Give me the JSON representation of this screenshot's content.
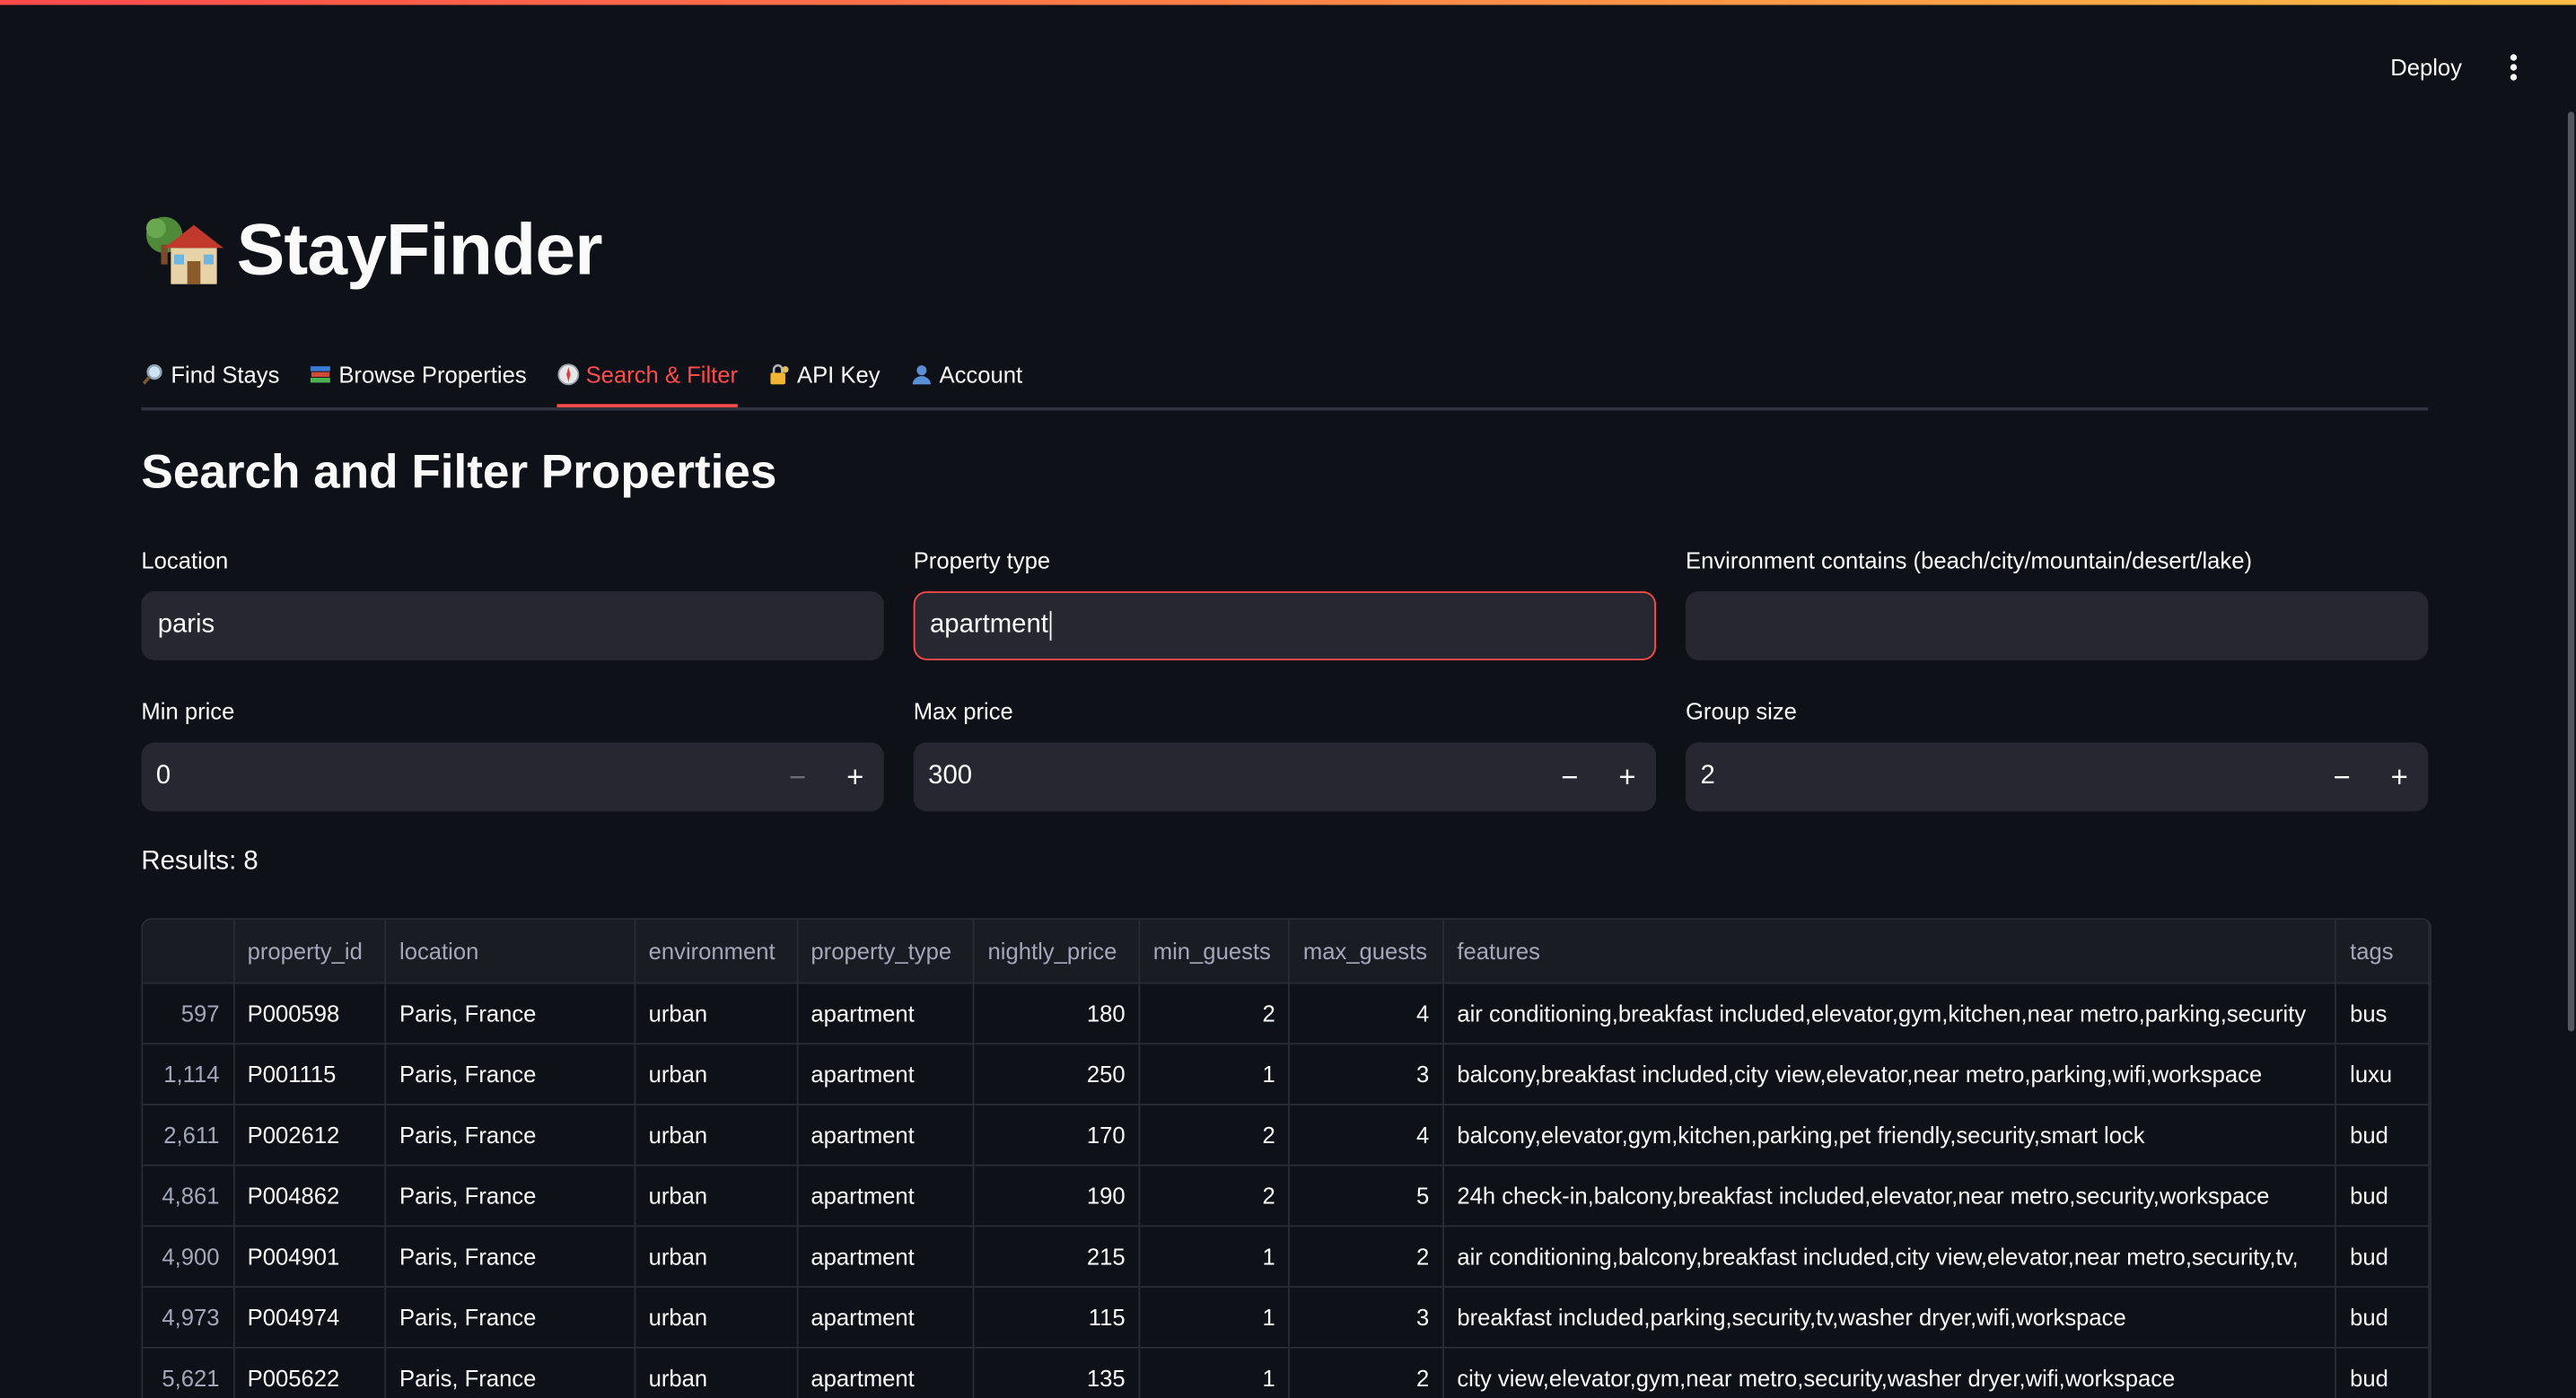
{
  "header": {
    "deploy_label": "Deploy",
    "menu_icon": "kebab-menu-icon",
    "accent_gradient": [
      "#ff4b4b",
      "#ffbd45"
    ]
  },
  "app": {
    "title": "StayFinder",
    "title_icon": "house-with-tree-icon"
  },
  "tabs": [
    {
      "label": "Find Stays",
      "icon": "magnifier-icon",
      "active": false
    },
    {
      "label": "Browse Properties",
      "icon": "books-icon",
      "active": false
    },
    {
      "label": "Search & Filter",
      "icon": "compass-icon",
      "active": true
    },
    {
      "label": "API Key",
      "icon": "lock-key-icon",
      "active": false
    },
    {
      "label": "Account",
      "icon": "person-icon",
      "active": false
    }
  ],
  "section": {
    "heading": "Search and Filter Properties"
  },
  "filters": {
    "location": {
      "label": "Location",
      "value": "paris"
    },
    "property_type": {
      "label": "Property type",
      "value": "apartment"
    },
    "environment": {
      "label": "Environment contains (beach/city/mountain/desert/lake)",
      "value": ""
    },
    "min_price": {
      "label": "Min price",
      "value": "0"
    },
    "max_price": {
      "label": "Max price",
      "value": "300"
    },
    "group_size": {
      "label": "Group size",
      "value": "2"
    },
    "minus": "−",
    "plus": "+"
  },
  "results": {
    "label": "Results: 8"
  },
  "table": {
    "columns": [
      "",
      "property_id",
      "location",
      "environment",
      "property_type",
      "nightly_price",
      "min_guests",
      "max_guests",
      "features",
      "tags"
    ],
    "rows": [
      [
        "597",
        "P000598",
        "Paris, France",
        "urban",
        "apartment",
        "180",
        "2",
        "4",
        "air conditioning,breakfast included,elevator,gym,kitchen,near metro,parking,security",
        "bus"
      ],
      [
        "1,114",
        "P001115",
        "Paris, France",
        "urban",
        "apartment",
        "250",
        "1",
        "3",
        "balcony,breakfast included,city view,elevator,near metro,parking,wifi,workspace",
        "luxu"
      ],
      [
        "2,611",
        "P002612",
        "Paris, France",
        "urban",
        "apartment",
        "170",
        "2",
        "4",
        "balcony,elevator,gym,kitchen,parking,pet friendly,security,smart lock",
        "bud"
      ],
      [
        "4,861",
        "P004862",
        "Paris, France",
        "urban",
        "apartment",
        "190",
        "2",
        "5",
        "24h check-in,balcony,breakfast included,elevator,near metro,security,workspace",
        "bud"
      ],
      [
        "4,900",
        "P004901",
        "Paris, France",
        "urban",
        "apartment",
        "215",
        "1",
        "2",
        "air conditioning,balcony,breakfast included,city view,elevator,near metro,security,tv,",
        "bud"
      ],
      [
        "4,973",
        "P004974",
        "Paris, France",
        "urban",
        "apartment",
        "115",
        "1",
        "3",
        "breakfast included,parking,security,tv,washer dryer,wifi,workspace",
        "bud"
      ],
      [
        "5,621",
        "P005622",
        "Paris, France",
        "urban",
        "apartment",
        "135",
        "1",
        "2",
        "city view,elevator,gym,near metro,security,washer dryer,wifi,workspace",
        "bud"
      ]
    ]
  }
}
